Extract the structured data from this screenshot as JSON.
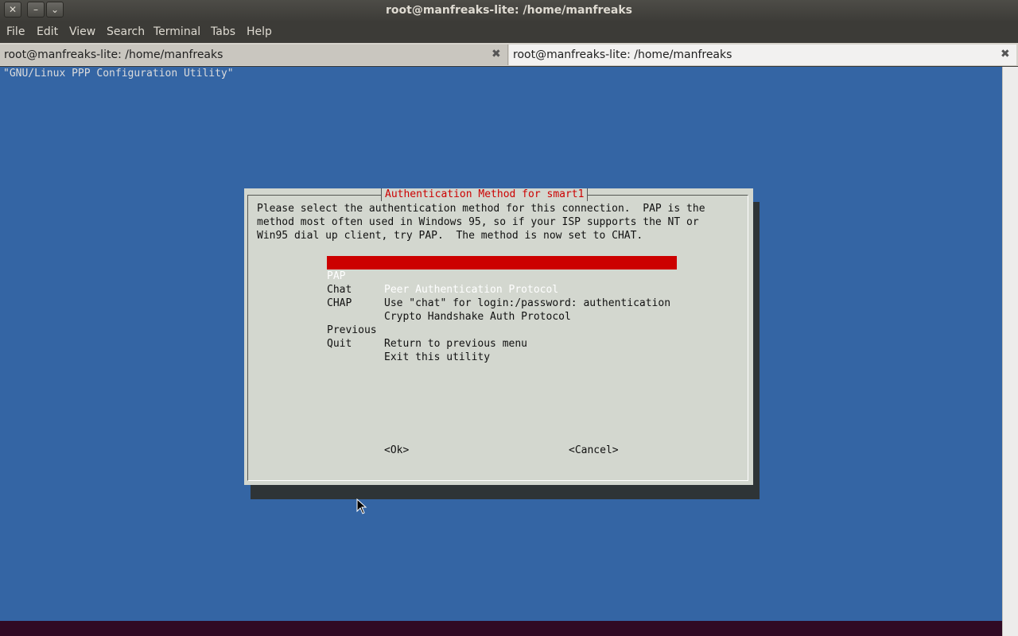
{
  "window": {
    "title": "root@manfreaks-lite: /home/manfreaks",
    "controls": {
      "close": "✕",
      "minimize": "–",
      "maximize": "⌄"
    }
  },
  "menubar": [
    "File",
    "Edit",
    "View",
    "Search",
    "Terminal",
    "Tabs",
    "Help"
  ],
  "tabs": [
    {
      "label": "root@manfreaks-lite: /home/manfreaks",
      "active": false,
      "close": "✖"
    },
    {
      "label": "root@manfreaks-lite: /home/manfreaks",
      "active": true,
      "close": "✖"
    }
  ],
  "terminal": {
    "backtitle": "\"GNU/Linux PPP Configuration Utility\"",
    "dialog": {
      "title": "Authentication Method for smart1",
      "text": "Please select the authentication method for this connection.  PAP is the\nmethod most often used in Windows 95, so if your ISP supports the NT or\nWin95 dial up client, try PAP.  The method is now set to CHAT.",
      "options": [
        {
          "tag": "PAP",
          "desc": "Peer Authentication Protocol",
          "selected": true
        },
        {
          "tag": "Chat",
          "desc": "Use \"chat\" for login:/password: authentication",
          "selected": false
        },
        {
          "tag": "CHAP",
          "desc": "Crypto Handshake Auth Protocol",
          "selected": false
        },
        {
          "tag": "Previous",
          "desc": "Return to previous menu",
          "selected": false
        },
        {
          "tag": "Quit",
          "desc": "Exit this utility",
          "selected": false
        }
      ],
      "ok_label": "<Ok>",
      "cancel_label": "<Cancel>"
    }
  },
  "colors": {
    "terminal_bg": "#3465a4",
    "dialog_bg": "#d3d7cf",
    "selection": "#cc0000",
    "title_text": "#cc0000"
  }
}
